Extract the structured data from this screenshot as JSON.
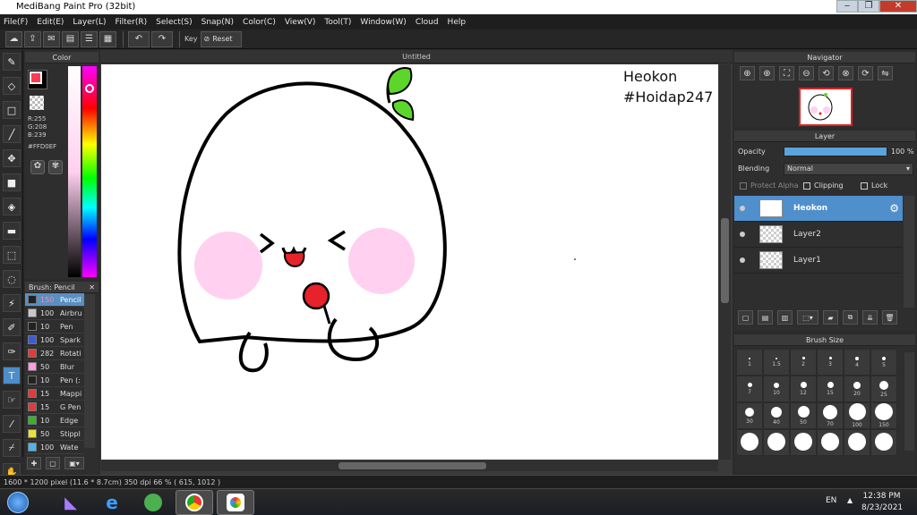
{
  "window": {
    "title": "MediBang Paint Pro (32bit)"
  },
  "menu": [
    "File(F)",
    "Edit(E)",
    "Layer(L)",
    "Filter(R)",
    "Select(S)",
    "Snap(N)",
    "Color(C)",
    "View(V)",
    "Tool(T)",
    "Window(W)",
    "Cloud",
    "Help"
  ],
  "toolbar": {
    "key_label": "Key",
    "reset_label": "Reset"
  },
  "color_panel": {
    "title": "Color",
    "r": "R:255",
    "g": "G:208",
    "b": "B:239",
    "hex": "#FFD0EF",
    "fg_color": "#ff3b52",
    "current_color": "#FFD0EF"
  },
  "brush_panel": {
    "title": "Brush: Pencil",
    "brushes": [
      {
        "size": "150",
        "name": "Pencil",
        "color": "#222222",
        "selected": true
      },
      {
        "size": "100",
        "name": "Airbru",
        "color": "#c8c8c8"
      },
      {
        "size": "10",
        "name": "Pen",
        "color": "#222222"
      },
      {
        "size": "100",
        "name": "Spark",
        "color": "#3a5bd8"
      },
      {
        "size": "282",
        "name": "Rotati",
        "color": "#e23b3b"
      },
      {
        "size": "50",
        "name": "Blur",
        "color": "#ff9be0"
      },
      {
        "size": "10",
        "name": "Pen (:",
        "color": "#222222"
      },
      {
        "size": "15",
        "name": "Mappi",
        "color": "#e23b3b"
      },
      {
        "size": "15",
        "name": "G Pen",
        "color": "#e23b3b"
      },
      {
        "size": "10",
        "name": "Edge",
        "color": "#35b52a"
      },
      {
        "size": "50",
        "name": "Stippl",
        "color": "#e8e13a"
      },
      {
        "size": "100",
        "name": "Wate",
        "color": "#4fb4e8"
      }
    ]
  },
  "canvas": {
    "title": "Untitled",
    "text_line1": "Heokon",
    "text_line2": "#Hoidap247"
  },
  "navigator": {
    "title": "Navigator"
  },
  "layer_panel": {
    "title": "Layer",
    "opacity_label": "Opacity",
    "opacity_value": "100 %",
    "opacity_fraction": 1.0,
    "blending_label": "Blending",
    "blending_value": "Normal",
    "protect_alpha_label": "Protect Alpha",
    "clipping_label": "Clipping",
    "lock_label": "Lock",
    "layers": [
      {
        "name": "Heokon",
        "selected": true
      },
      {
        "name": "Layer2",
        "selected": false
      },
      {
        "name": "Layer1",
        "selected": false
      }
    ]
  },
  "brush_size_panel": {
    "title": "Brush Size",
    "sizes": [
      "1",
      "1.5",
      "2",
      "3",
      "4",
      "5",
      "7",
      "10",
      "12",
      "15",
      "20",
      "25",
      "30",
      "40",
      "50",
      "70",
      "100",
      "150",
      "",
      "",
      "",
      "",
      "",
      ""
    ]
  },
  "status": {
    "dimensions": "1600 * 1200 pixel",
    "physical": "(11.6 * 8.7cm)",
    "dpi": "350 dpi",
    "zoom": "66 %",
    "coords": "( 615, 1012 )"
  },
  "taskbar": {
    "lang": "EN",
    "time": "12:38 PM",
    "date": "8/23/2021"
  }
}
